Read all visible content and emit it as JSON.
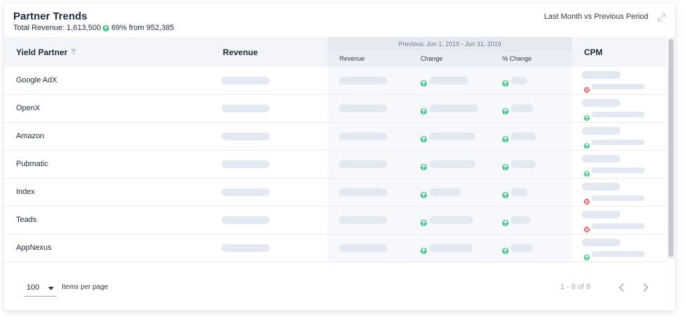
{
  "header": {
    "title": "Partner Trends",
    "total_label": "Total Revenue: 1,613,500",
    "change_text": "69% from 952,385",
    "period": "Last Month vs Previous Period"
  },
  "table": {
    "col_partner": "Yield Partner",
    "col_revenue": "Revenue",
    "prev_group": "Previous:  Jun 1, 2019 - Jun 31, 2019",
    "prev_revenue": "Revenue",
    "prev_change": "Change",
    "prev_pct_change": "% Change",
    "col_cpm": "CPM",
    "rows": [
      {
        "partner": "Google AdX",
        "cpm_trend": "down"
      },
      {
        "partner": "OpenX",
        "cpm_trend": "up"
      },
      {
        "partner": "Amazon",
        "cpm_trend": "up"
      },
      {
        "partner": "Pubmatic",
        "cpm_trend": "up"
      },
      {
        "partner": "Index",
        "cpm_trend": "down"
      },
      {
        "partner": "Teads",
        "cpm_trend": "down"
      },
      {
        "partner": "AppNexus",
        "cpm_trend": "up"
      }
    ]
  },
  "footer": {
    "per_page_value": "100",
    "per_page_label": "Items per page",
    "range": "1 - 8 of 8"
  },
  "colors": {
    "up": "#2dbd78",
    "down": "#e54b5b",
    "skeleton": "#e3e9f2"
  },
  "icons": [
    "filter-icon",
    "expand-icon",
    "arrow-up-icon",
    "arrow-down-icon",
    "chevron-left-icon",
    "chevron-right-icon"
  ]
}
